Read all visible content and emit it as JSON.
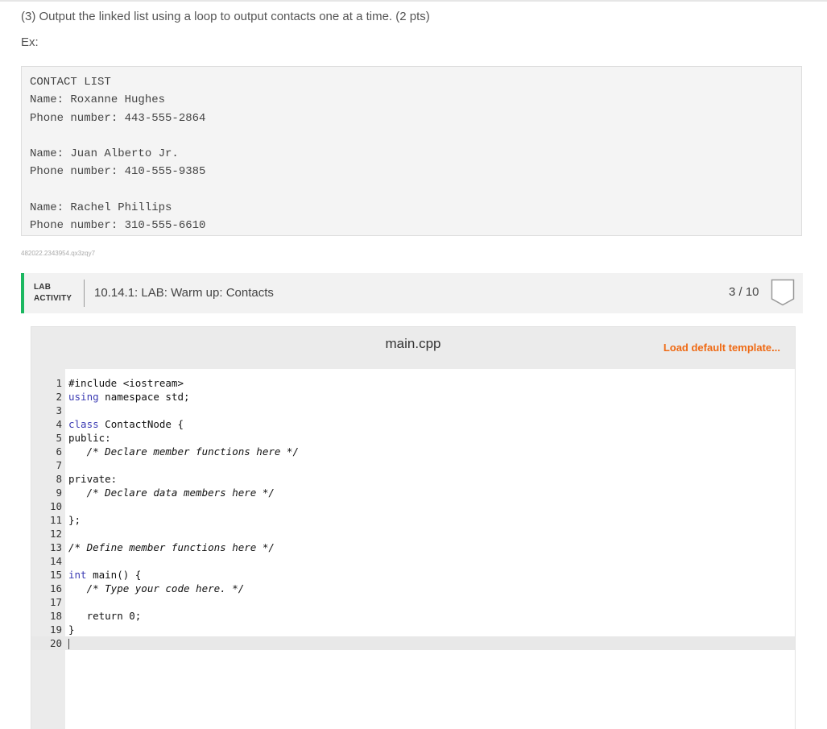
{
  "prompt": {
    "instruction": "(3) Output the linked list using a loop to output contacts one at a time. (2 pts)",
    "example_label": "Ex:"
  },
  "example_output": "CONTACT LIST\nName: Roxanne Hughes\nPhone number: 443-555-2864\n\nName: Juan Alberto Jr.\nPhone number: 410-555-9385\n\nName: Rachel Phillips\nPhone number: 310-555-6610",
  "meta_id": "482022.2343954.qx3zqy7",
  "lab": {
    "tag_line1": "LAB",
    "tag_line2": "ACTIVITY",
    "title": "10.14.1: LAB: Warm up: Contacts",
    "score": "3 / 10"
  },
  "editor": {
    "filename": "main.cpp",
    "load_template_label": "Load default template...",
    "line_numbers": [
      "1",
      "2",
      "3",
      "4",
      "5",
      "6",
      "7",
      "8",
      "9",
      "10",
      "11",
      "12",
      "13",
      "14",
      "15",
      "16",
      "17",
      "18",
      "19",
      "20"
    ],
    "code": {
      "l1": "#include <iostream>",
      "l2_kw": "using",
      "l2_rest": " namespace std;",
      "l4_kw": "class",
      "l4_rest": " ContactNode {",
      "l5": "public:",
      "l6": "   /* Declare member functions here */",
      "l8": "private:",
      "l9": "   /* Declare data members here */",
      "l11": "};",
      "l13": "/* Define member functions here */",
      "l15_kw": "int",
      "l15_rest": " main() {",
      "l16": "   /* Type your code here. */",
      "l18": "   return 0;",
      "l19": "}"
    }
  },
  "colors": {
    "accent_green": "#1bb760",
    "load_orange": "#ef6a14"
  }
}
